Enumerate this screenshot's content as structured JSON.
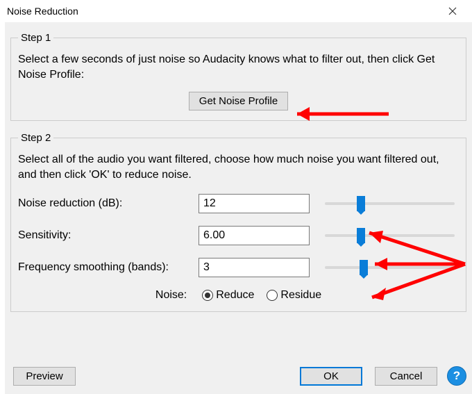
{
  "window": {
    "title": "Noise Reduction"
  },
  "step1": {
    "legend": "Step 1",
    "instruction": "Select a few seconds of just noise so Audacity knows what to filter out, then click Get Noise Profile:",
    "button": "Get Noise Profile"
  },
  "step2": {
    "legend": "Step 2",
    "instruction": "Select all of the audio you want filtered, choose how much noise you want filtered out, and then click 'OK' to reduce noise.",
    "noise_reduction": {
      "label": "Noise reduction (dB):",
      "value": "12",
      "slider_pct": 28
    },
    "sensitivity": {
      "label": "Sensitivity:",
      "value": "6.00",
      "slider_pct": 28
    },
    "frequency_smoothing": {
      "label": "Frequency smoothing (bands):",
      "value": "3",
      "slider_pct": 30
    },
    "noise_label": "Noise:",
    "radio": {
      "reduce": "Reduce",
      "residue": "Residue",
      "selected": "reduce"
    }
  },
  "footer": {
    "preview": "Preview",
    "ok": "OK",
    "cancel": "Cancel",
    "help": "?"
  }
}
